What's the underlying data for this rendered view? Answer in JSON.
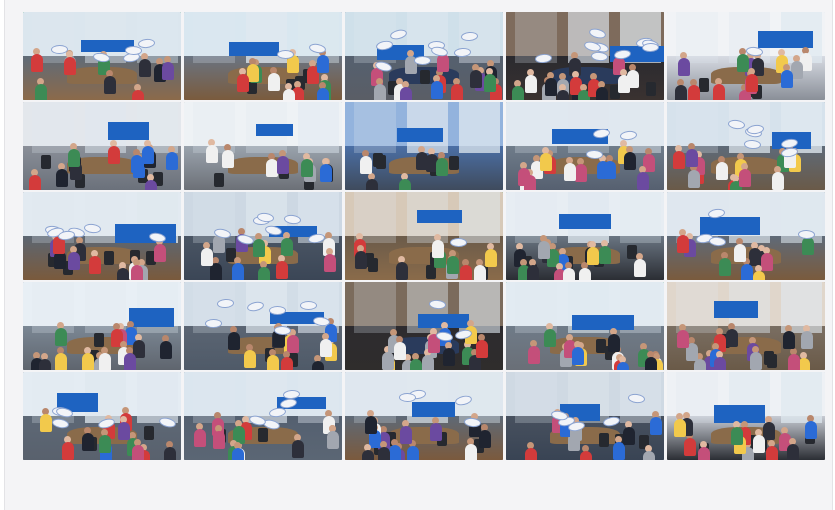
{
  "app": {
    "title": ""
  },
  "video_grid": {
    "rows": 5,
    "columns": 5,
    "active_tiles": [
      0,
      12,
      18
    ],
    "tiles": [
      {
        "id": "t1",
        "bg": "#5f6b78",
        "wall": "#dbe6ee",
        "carpet": "#8b6a4a",
        "people": 10,
        "signs": 5,
        "banner": "",
        "seed": 3
      },
      {
        "id": "t2",
        "bg": "#6a7482",
        "wall": "#d9e7f0",
        "carpet": "#7a5b3d",
        "people": 12,
        "signs": 2,
        "banner": "",
        "seed": 7
      },
      {
        "id": "t3",
        "bg": "#55606f",
        "wall": "#cfe0ea",
        "carpet": "#5a5e66",
        "people": 14,
        "signs": 8,
        "banner": "",
        "seed": 11
      },
      {
        "id": "t4",
        "bg": "#2a2a2f",
        "wall": "#7e6b5c",
        "carpet": "#3a3230",
        "people": 16,
        "signs": 9,
        "banner": "",
        "seed": 13
      },
      {
        "id": "t5",
        "bg": "#d7dbe3",
        "wall": "#f1f3f6",
        "carpet": "#8a8f98",
        "people": 14,
        "signs": 1,
        "banner": "",
        "seed": 17
      },
      {
        "id": "t6",
        "bg": "#8a8f98",
        "wall": "#e3e7ec",
        "carpet": "#6b717b",
        "people": 12,
        "signs": 0,
        "banner": "",
        "seed": 19
      },
      {
        "id": "t7",
        "bg": "#9aa3ad",
        "wall": "#eef2f5",
        "carpet": "#6c7077",
        "people": 8,
        "signs": 0,
        "banner": "",
        "seed": 23
      },
      {
        "id": "t8",
        "bg": "#4b6fa5",
        "wall": "#93b3dd",
        "carpet": "#3f4b5d",
        "people": 6,
        "signs": 0,
        "banner": "",
        "seed": 29
      },
      {
        "id": "t9",
        "bg": "#6f7c8a",
        "wall": "#e0e8f0",
        "carpet": "#566070",
        "people": 14,
        "signs": 3,
        "banner": "",
        "seed": 31
      },
      {
        "id": "t10",
        "bg": "#5e6a78",
        "wall": "#d6e2ec",
        "carpet": "#6a5a48",
        "people": 14,
        "signs": 6,
        "banner": "",
        "seed": 37
      },
      {
        "id": "t11",
        "bg": "#5c6672",
        "wall": "#e2eaf1",
        "carpet": "#7a5a3c",
        "people": 12,
        "signs": 6,
        "banner": "",
        "seed": 41
      },
      {
        "id": "t12",
        "bg": "#4a5564",
        "wall": "#cdd8e3",
        "carpet": "#3b4656",
        "people": 12,
        "signs": 7,
        "banner": "",
        "seed": 43
      },
      {
        "id": "t13",
        "bg": "#6b5b4a",
        "wall": "#d7c9b8",
        "carpet": "#8a6b4a",
        "people": 10,
        "signs": 1,
        "banner": "",
        "seed": 47
      },
      {
        "id": "t14",
        "bg": "#6a7582",
        "wall": "#e7edf3",
        "carpet": "#2b2e34",
        "people": 14,
        "signs": 0,
        "banner": "",
        "seed": 53
      },
      {
        "id": "t15",
        "bg": "#5f6a78",
        "wall": "#dfe7ef",
        "carpet": "#7a5b3d",
        "people": 10,
        "signs": 4,
        "banner": "",
        "seed": 59
      },
      {
        "id": "t16",
        "bg": "#7b8794",
        "wall": "#e8eff5",
        "carpet": "#5f656e",
        "people": 14,
        "signs": 0,
        "banner": "",
        "seed": 61
      },
      {
        "id": "t17",
        "bg": "#5b6573",
        "wall": "#d2dde7",
        "carpet": "#4f5a68",
        "people": 12,
        "signs": 7,
        "banner": "",
        "seed": 67
      },
      {
        "id": "t18",
        "bg": "#2d2b2f",
        "wall": "#7b6b5c",
        "carpet": "#2f2d2c",
        "people": 16,
        "signs": 3,
        "banner": "",
        "seed": 71
      },
      {
        "id": "t19",
        "bg": "#6f7b88",
        "wall": "#e2ebf2",
        "carpet": "#6a6f77",
        "people": 14,
        "signs": 0,
        "banner": "",
        "seed": 73
      },
      {
        "id": "t20",
        "bg": "#7a6e62",
        "wall": "#e0d6cb",
        "carpet": "#6a5a48",
        "people": 14,
        "signs": 0,
        "banner": "",
        "seed": 79
      },
      {
        "id": "t21",
        "bg": "#5d6876",
        "wall": "#e4ecf3",
        "carpet": "#59616d",
        "people": 12,
        "signs": 5,
        "banner": "",
        "seed": 83
      },
      {
        "id": "t22",
        "bg": "#546070",
        "wall": "#dbe6ef",
        "carpet": "#5b6674",
        "people": 12,
        "signs": 5,
        "banner": "",
        "seed": 89
      },
      {
        "id": "t23",
        "bg": "#5e6976",
        "wall": "#dfe7ef",
        "carpet": "#7b5a3d",
        "people": 14,
        "signs": 4,
        "banner": "",
        "seed": 97
      },
      {
        "id": "t24",
        "bg": "#48515f",
        "wall": "#cfd9e3",
        "carpet": "#394454",
        "people": 10,
        "signs": 5,
        "banner": "",
        "seed": 101
      },
      {
        "id": "t25",
        "bg": "#c7cbd3",
        "wall": "#eef1f5",
        "carpet": "#2b2e34",
        "people": 14,
        "signs": 0,
        "banner": "",
        "seed": 103
      }
    ]
  }
}
